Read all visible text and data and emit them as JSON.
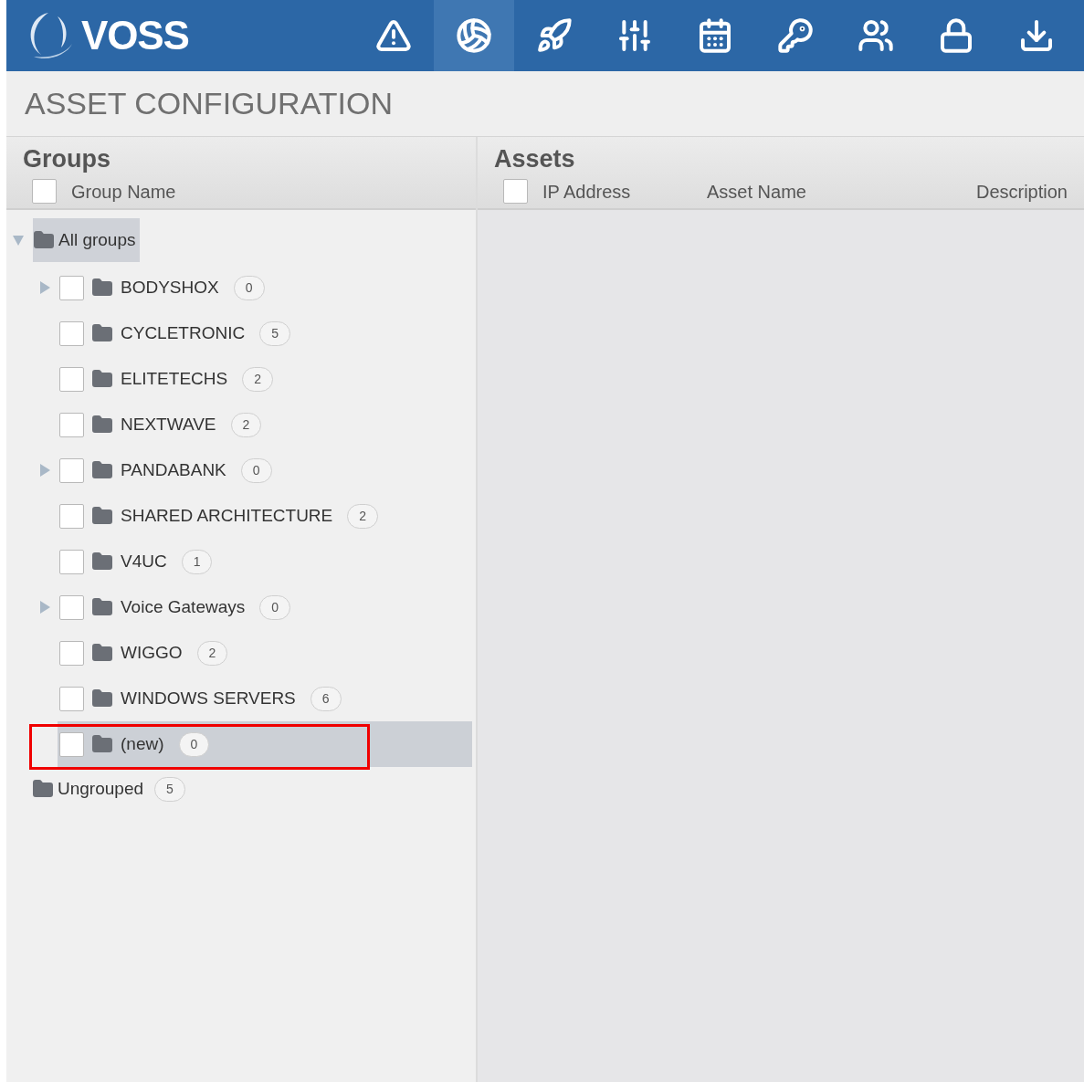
{
  "header": {
    "logo": "VOSS",
    "toolbar": [
      {
        "selected": false
      },
      {
        "selected": true
      },
      {
        "selected": false
      },
      {
        "selected": false
      },
      {
        "selected": false
      },
      {
        "selected": false
      },
      {
        "selected": false
      },
      {
        "selected": false
      },
      {
        "selected": false
      }
    ]
  },
  "page_title": "ASSET CONFIGURATION",
  "groups_panel": {
    "title": "Groups",
    "columns": [
      "Group Name"
    ],
    "select_all_checked": false,
    "tree": {
      "label": "All groups",
      "expanded": true,
      "selected": true,
      "children": [
        {
          "label": "BODYSHOX",
          "count": "0",
          "expandable": true,
          "checked": false,
          "selected": false,
          "annotated": false
        },
        {
          "label": "CYCLETRONIC",
          "count": "5",
          "expandable": false,
          "checked": false,
          "selected": false,
          "annotated": false
        },
        {
          "label": "ELITETECHS",
          "count": "2",
          "expandable": false,
          "checked": false,
          "selected": false,
          "annotated": false
        },
        {
          "label": "NEXTWAVE",
          "count": "2",
          "expandable": false,
          "checked": false,
          "selected": false,
          "annotated": false
        },
        {
          "label": "PANDABANK",
          "count": "0",
          "expandable": true,
          "checked": false,
          "selected": false,
          "annotated": false
        },
        {
          "label": "SHARED ARCHITECTURE",
          "count": "2",
          "expandable": false,
          "checked": false,
          "selected": false,
          "annotated": false
        },
        {
          "label": "V4UC",
          "count": "1",
          "expandable": false,
          "checked": false,
          "selected": false,
          "annotated": false
        },
        {
          "label": "Voice Gateways",
          "count": "0",
          "expandable": true,
          "checked": false,
          "selected": false,
          "annotated": false
        },
        {
          "label": "WIGGO",
          "count": "2",
          "expandable": false,
          "checked": false,
          "selected": false,
          "annotated": false
        },
        {
          "label": "WINDOWS SERVERS",
          "count": "6",
          "expandable": false,
          "checked": false,
          "selected": false,
          "annotated": false
        },
        {
          "label": "(new)",
          "count": "0",
          "expandable": false,
          "checked": false,
          "selected": true,
          "annotated": true
        }
      ]
    },
    "ungrouped": {
      "label": "Ungrouped",
      "count": "5"
    }
  },
  "assets_panel": {
    "title": "Assets",
    "select_all_checked": false,
    "columns": [
      "IP Address",
      "Asset Name",
      "Description"
    ]
  }
}
